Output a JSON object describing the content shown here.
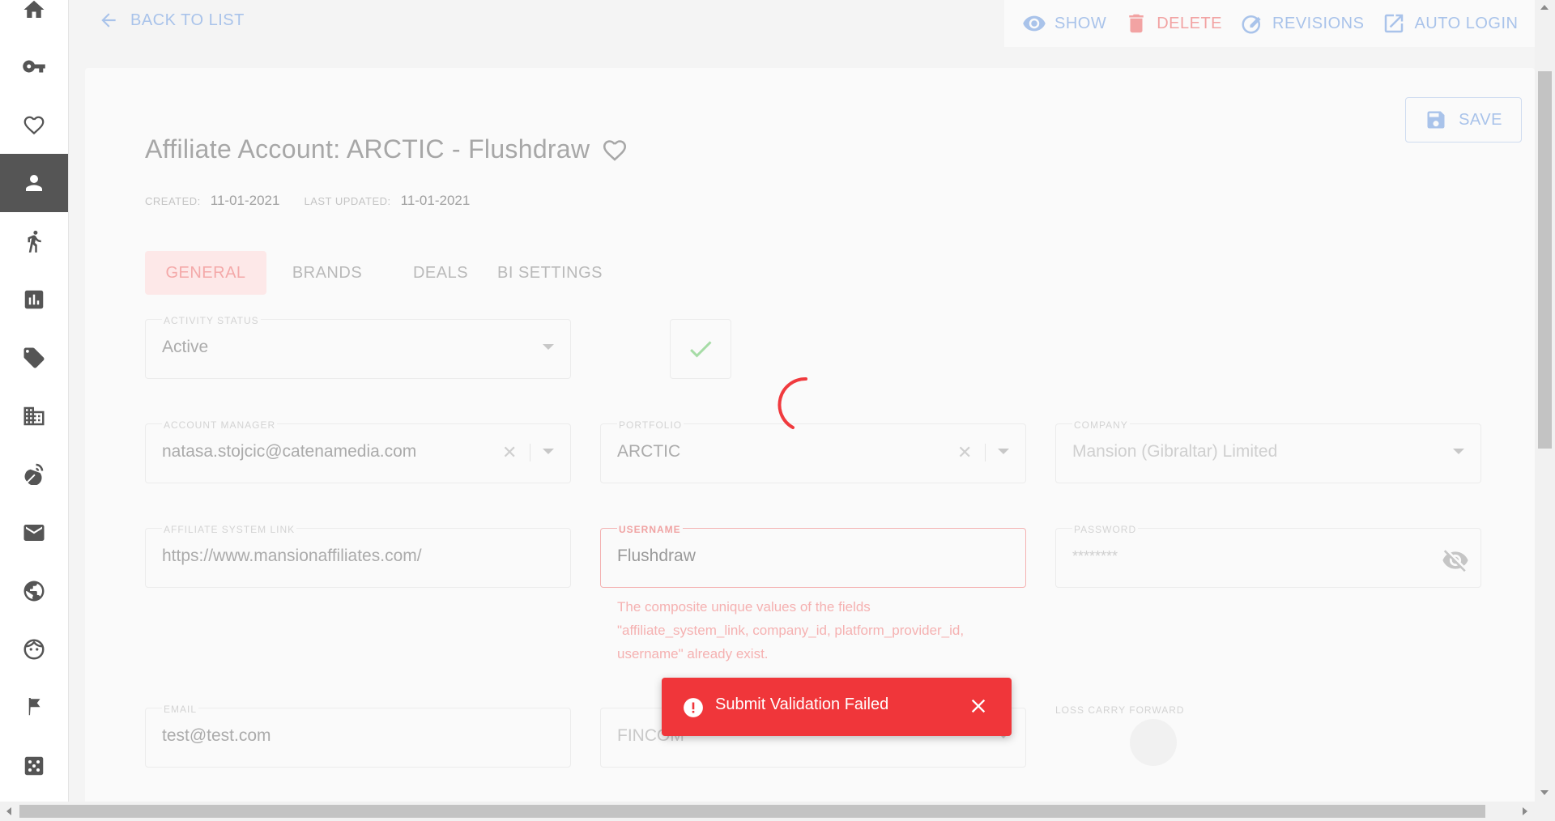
{
  "sidebar": {
    "items": [
      {
        "icon": "home-icon",
        "active": false
      },
      {
        "icon": "key-icon",
        "active": false
      },
      {
        "icon": "heart-icon",
        "active": false
      },
      {
        "icon": "person-icon",
        "active": true
      },
      {
        "icon": "runner-icon",
        "active": false
      },
      {
        "icon": "bar-chart-icon",
        "active": false
      },
      {
        "icon": "tag-icon",
        "active": false
      },
      {
        "icon": "building-icon",
        "active": false
      },
      {
        "icon": "satellite-icon",
        "active": false
      },
      {
        "icon": "mail-icon",
        "active": false
      },
      {
        "icon": "globe-icon",
        "active": false
      },
      {
        "icon": "face-icon",
        "active": false
      },
      {
        "icon": "flag-icon",
        "active": false
      },
      {
        "icon": "dice-icon",
        "active": false
      }
    ]
  },
  "topbar": {
    "back_label": "BACK TO LIST",
    "actions": {
      "show": "SHOW",
      "delete": "DELETE",
      "revisions": "REVISIONS",
      "auto_login": "AUTO LOGIN"
    }
  },
  "page": {
    "title": "Affiliate Account: ARCTIC - Flushdraw",
    "save_label": "SAVE",
    "created_label": "CREATED:",
    "created_value": "11-01-2021",
    "updated_label": "LAST UPDATED:",
    "updated_value": "11-01-2021"
  },
  "tabs": [
    {
      "label": "GENERAL",
      "active": true
    },
    {
      "label": "BRANDS",
      "active": false
    },
    {
      "label": "DEALS",
      "active": false
    },
    {
      "label": "BI SETTINGS",
      "active": false
    }
  ],
  "form": {
    "activity_status": {
      "label": "ACTIVITY STATUS",
      "value": "Active"
    },
    "account_manager": {
      "label": "ACCOUNT MANAGER",
      "value": "natasa.stojcic@catenamedia.com"
    },
    "portfolio": {
      "label": "PORTFOLIO",
      "value": "ARCTIC"
    },
    "company": {
      "label": "COMPANY",
      "value": "Mansion (Gibraltar) Limited"
    },
    "affiliate_system_link": {
      "label": "AFFILIATE SYSTEM LINK",
      "value": "https://www.mansionaffiliates.com/"
    },
    "username": {
      "label": "USERNAME",
      "value": "Flushdraw",
      "error": "The composite unique values of the fields \"affiliate_system_link, company_id, platform_provider_id, username\" already exist."
    },
    "password": {
      "label": "PASSWORD",
      "value": "********"
    },
    "email": {
      "label": "EMAIL",
      "value": "test@test.com"
    },
    "platform": {
      "value": "FINCOM"
    },
    "loss_carry_forward": {
      "label": "LOSS CARRY FORWARD"
    }
  },
  "toast": {
    "message": "Submit Validation Failed"
  },
  "colors": {
    "accent_blue": "#a9c3ea",
    "danger_red": "#f0363a",
    "active_sidebar": "#555555"
  }
}
